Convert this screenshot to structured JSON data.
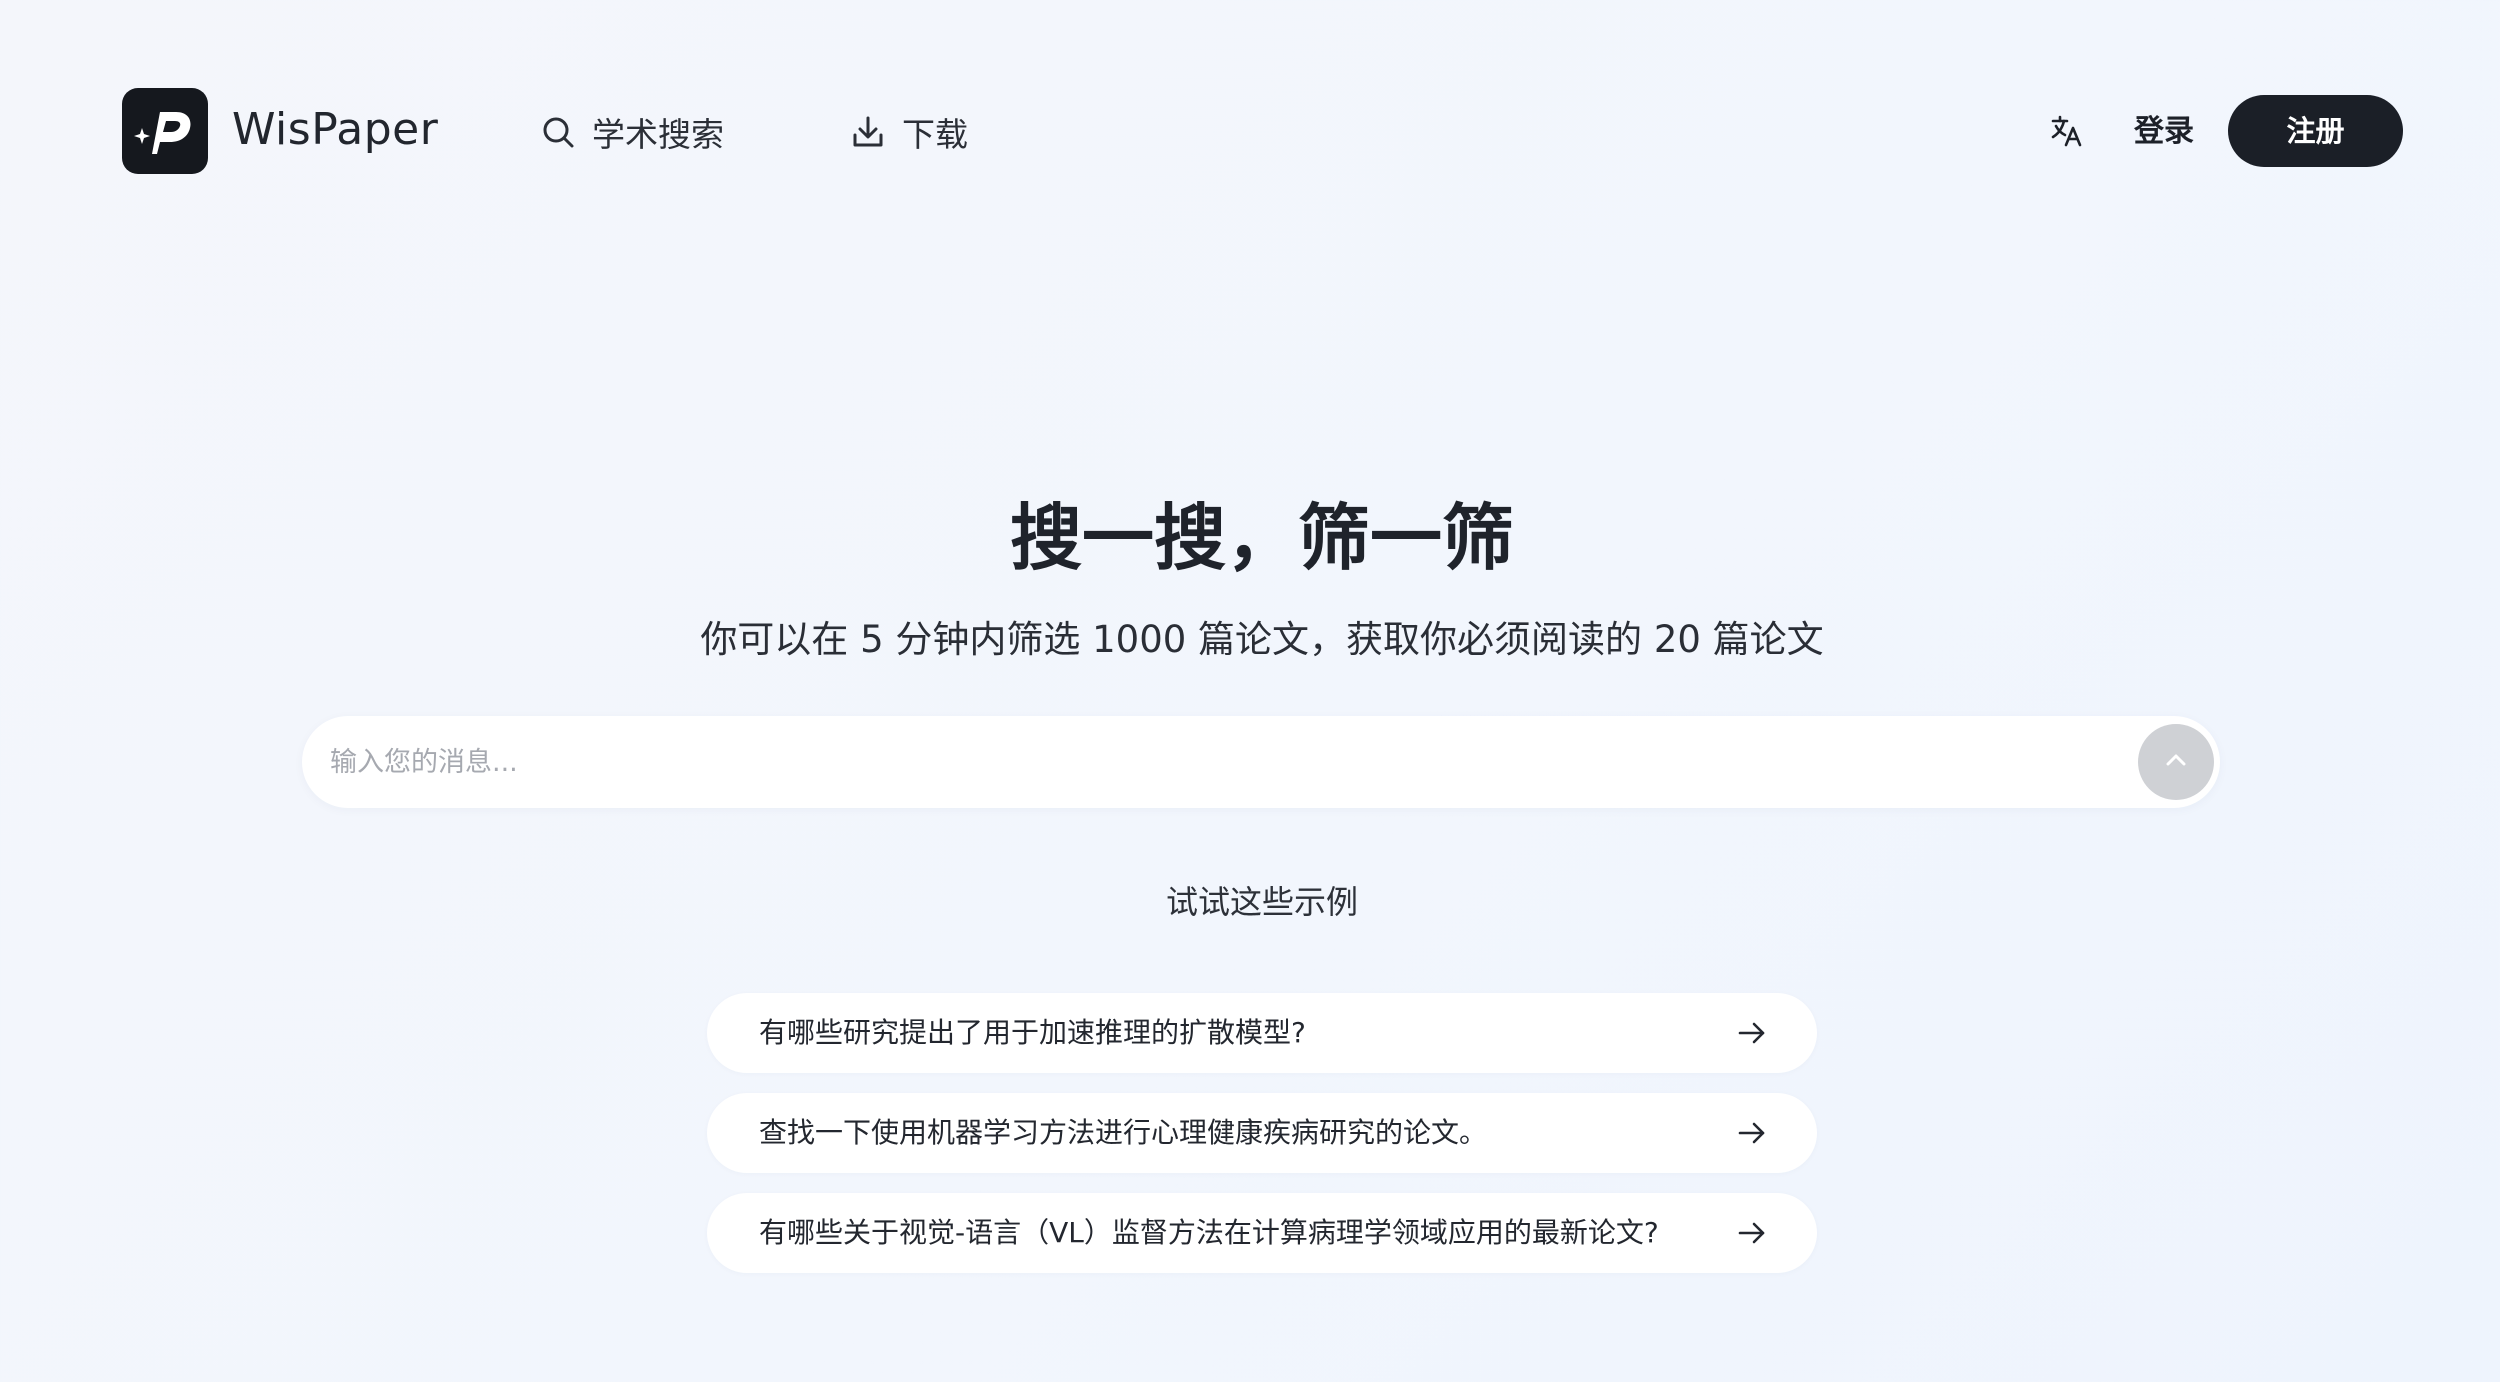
{
  "header": {
    "logo_text": "WisPaper",
    "nav": {
      "search_label": "学术搜索",
      "download_label": "下载"
    },
    "login_label": "登录",
    "signup_label": "注册"
  },
  "hero": {
    "title": "搜一搜，筛一筛",
    "subtitle": "你可以在 5 分钟内筛选 1000 篇论文，获取你必须阅读的 20 篇论文"
  },
  "search": {
    "placeholder": "输入您的消息..."
  },
  "examples": {
    "title": "试试这些示例",
    "items": [
      {
        "text": "有哪些研究提出了用于加速推理的扩散模型?"
      },
      {
        "text": "查找一下使用机器学习方法进行心理健康疾病研究的论文。"
      },
      {
        "text": "有哪些关于视觉-语言（VL）监督方法在计算病理学领域应用的最新论文?"
      }
    ]
  },
  "colors": {
    "background": "#f3f6fc",
    "primary_dark": "#1b1f27",
    "send_button_disabled": "#cfd1d5"
  },
  "icons": {
    "logo": "wispaper-logo-icon",
    "search": "search-icon",
    "download": "download-icon",
    "language": "translate-icon",
    "send": "chevron-up-icon",
    "example_arrow": "arrow-right-icon"
  }
}
